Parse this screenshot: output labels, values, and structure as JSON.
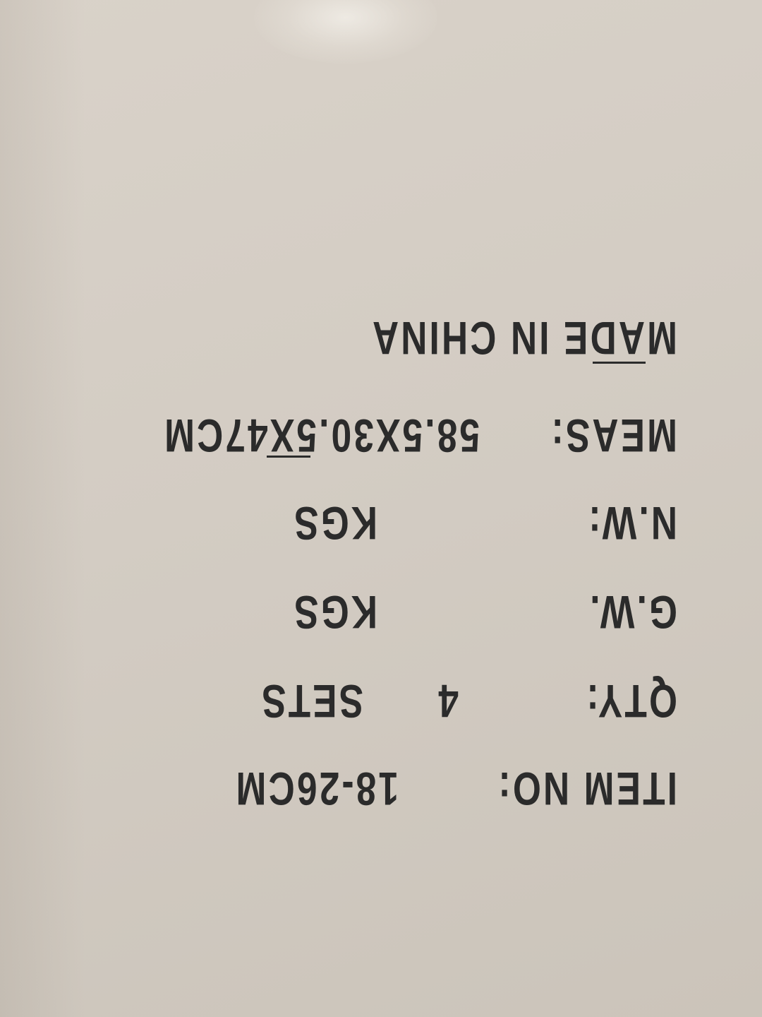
{
  "marking": {
    "item_label": "ITEM NO:",
    "item_value": "18-26CM",
    "qty_label": "QTY:",
    "qty_value": "4",
    "qty_unit": "SETS",
    "gw_label": "G.W.",
    "gw_unit": "KGS",
    "nw_label": "N.W:",
    "nw_unit": "KGS",
    "meas_label": "MEAS:",
    "meas_value": "58.5X30.5X47CM",
    "origin": "MADE IN CHINA"
  },
  "colors": {
    "cardboard": "#d6cfc6",
    "ink": "#2b2b2b"
  }
}
